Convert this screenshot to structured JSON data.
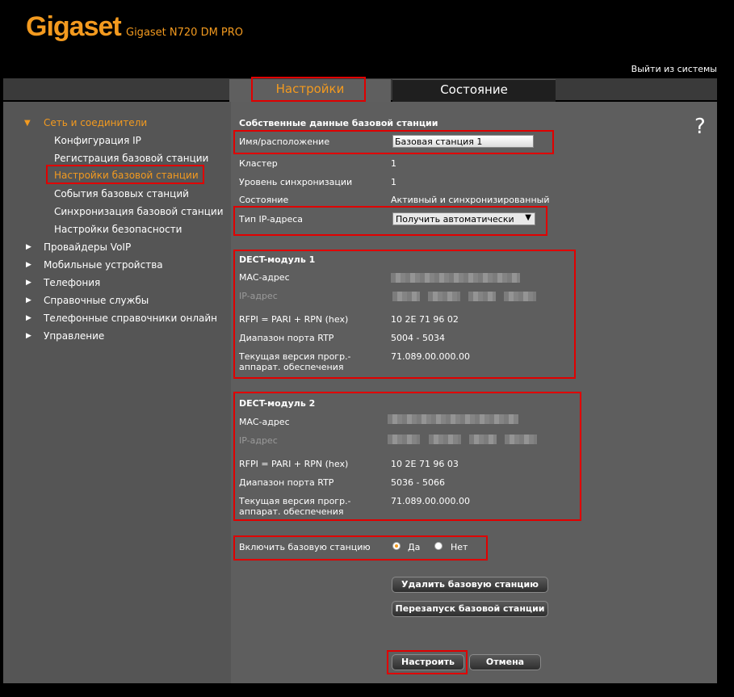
{
  "header": {
    "brand": "Gigaset",
    "model": "Gigaset N720 DM PRO",
    "logout": "Выйти из системы"
  },
  "tabs": [
    {
      "label": "Настройки",
      "active": true
    },
    {
      "label": "Состояние",
      "active": false
    }
  ],
  "sidebar": {
    "group_open": "Сеть и соединители",
    "sub_items": [
      "Конфигурация IP",
      "Регистрация базовой станции",
      "Настройки базовой станции",
      "События базовых станций",
      "Синхронизация базовой станции",
      "Настройки безопасности"
    ],
    "active_index": 2,
    "groups": [
      "Провайдеры VoIP",
      "Мобильные устройства",
      "Телефония",
      "Справочные службы",
      "Телефонные справочники онлайн",
      "Управление"
    ]
  },
  "help_icon": "?",
  "main": {
    "section_title": "Собственные данные базовой станции",
    "name_label": "Имя/расположение",
    "name_value": "Базовая станция 1",
    "cluster_label": "Кластер",
    "cluster_value": "1",
    "sync_level_label": "Уровень синхронизации",
    "sync_level_value": "1",
    "state_label": "Состояние",
    "state_value": "Активный и синхронизированный",
    "ip_type_label": "Тип IP-адреса",
    "ip_type_value": "Получить автоматически"
  },
  "dect1": {
    "title": "DECT-модуль 1",
    "mac_label": "MAC-адрес",
    "ip_label": "IP-адрес",
    "rfpi_label": "RFPI = PARI + RPN (hex)",
    "rfpi_value": "10 2E 71 96 02",
    "rtp_label": "Диапазон порта RTP",
    "rtp_value": "5004 - 5034",
    "fw_label_1": "Текущая версия прогр.-",
    "fw_label_2": "аппарат. обеспечения",
    "fw_value": "71.089.00.000.00"
  },
  "dect2": {
    "title": "DECT-модуль 2",
    "mac_label": "MAC-адрес",
    "ip_label": "IP-адрес",
    "rfpi_label": "RFPI = PARI + RPN (hex)",
    "rfpi_value": "10 2E 71 96 03",
    "rtp_label": "Диапазон порта RTP",
    "rtp_value": "5036 - 5066",
    "fw_label_1": "Текущая версия прогр.-",
    "fw_label_2": "аппарат. обеспечения",
    "fw_value": "71.089.00.000.00"
  },
  "enable": {
    "label": "Включить базовую станцию",
    "yes": "Да",
    "no": "Нет",
    "selected": "yes"
  },
  "buttons": {
    "delete": "Удалить базовую станцию",
    "restart": "Перезапуск базовой станции",
    "apply": "Настроить",
    "cancel": "Отмена"
  },
  "colors": {
    "accent": "#f39a1f",
    "highlight": "#e00000",
    "panel": "#5e5e5e",
    "sidebar": "#555555"
  }
}
